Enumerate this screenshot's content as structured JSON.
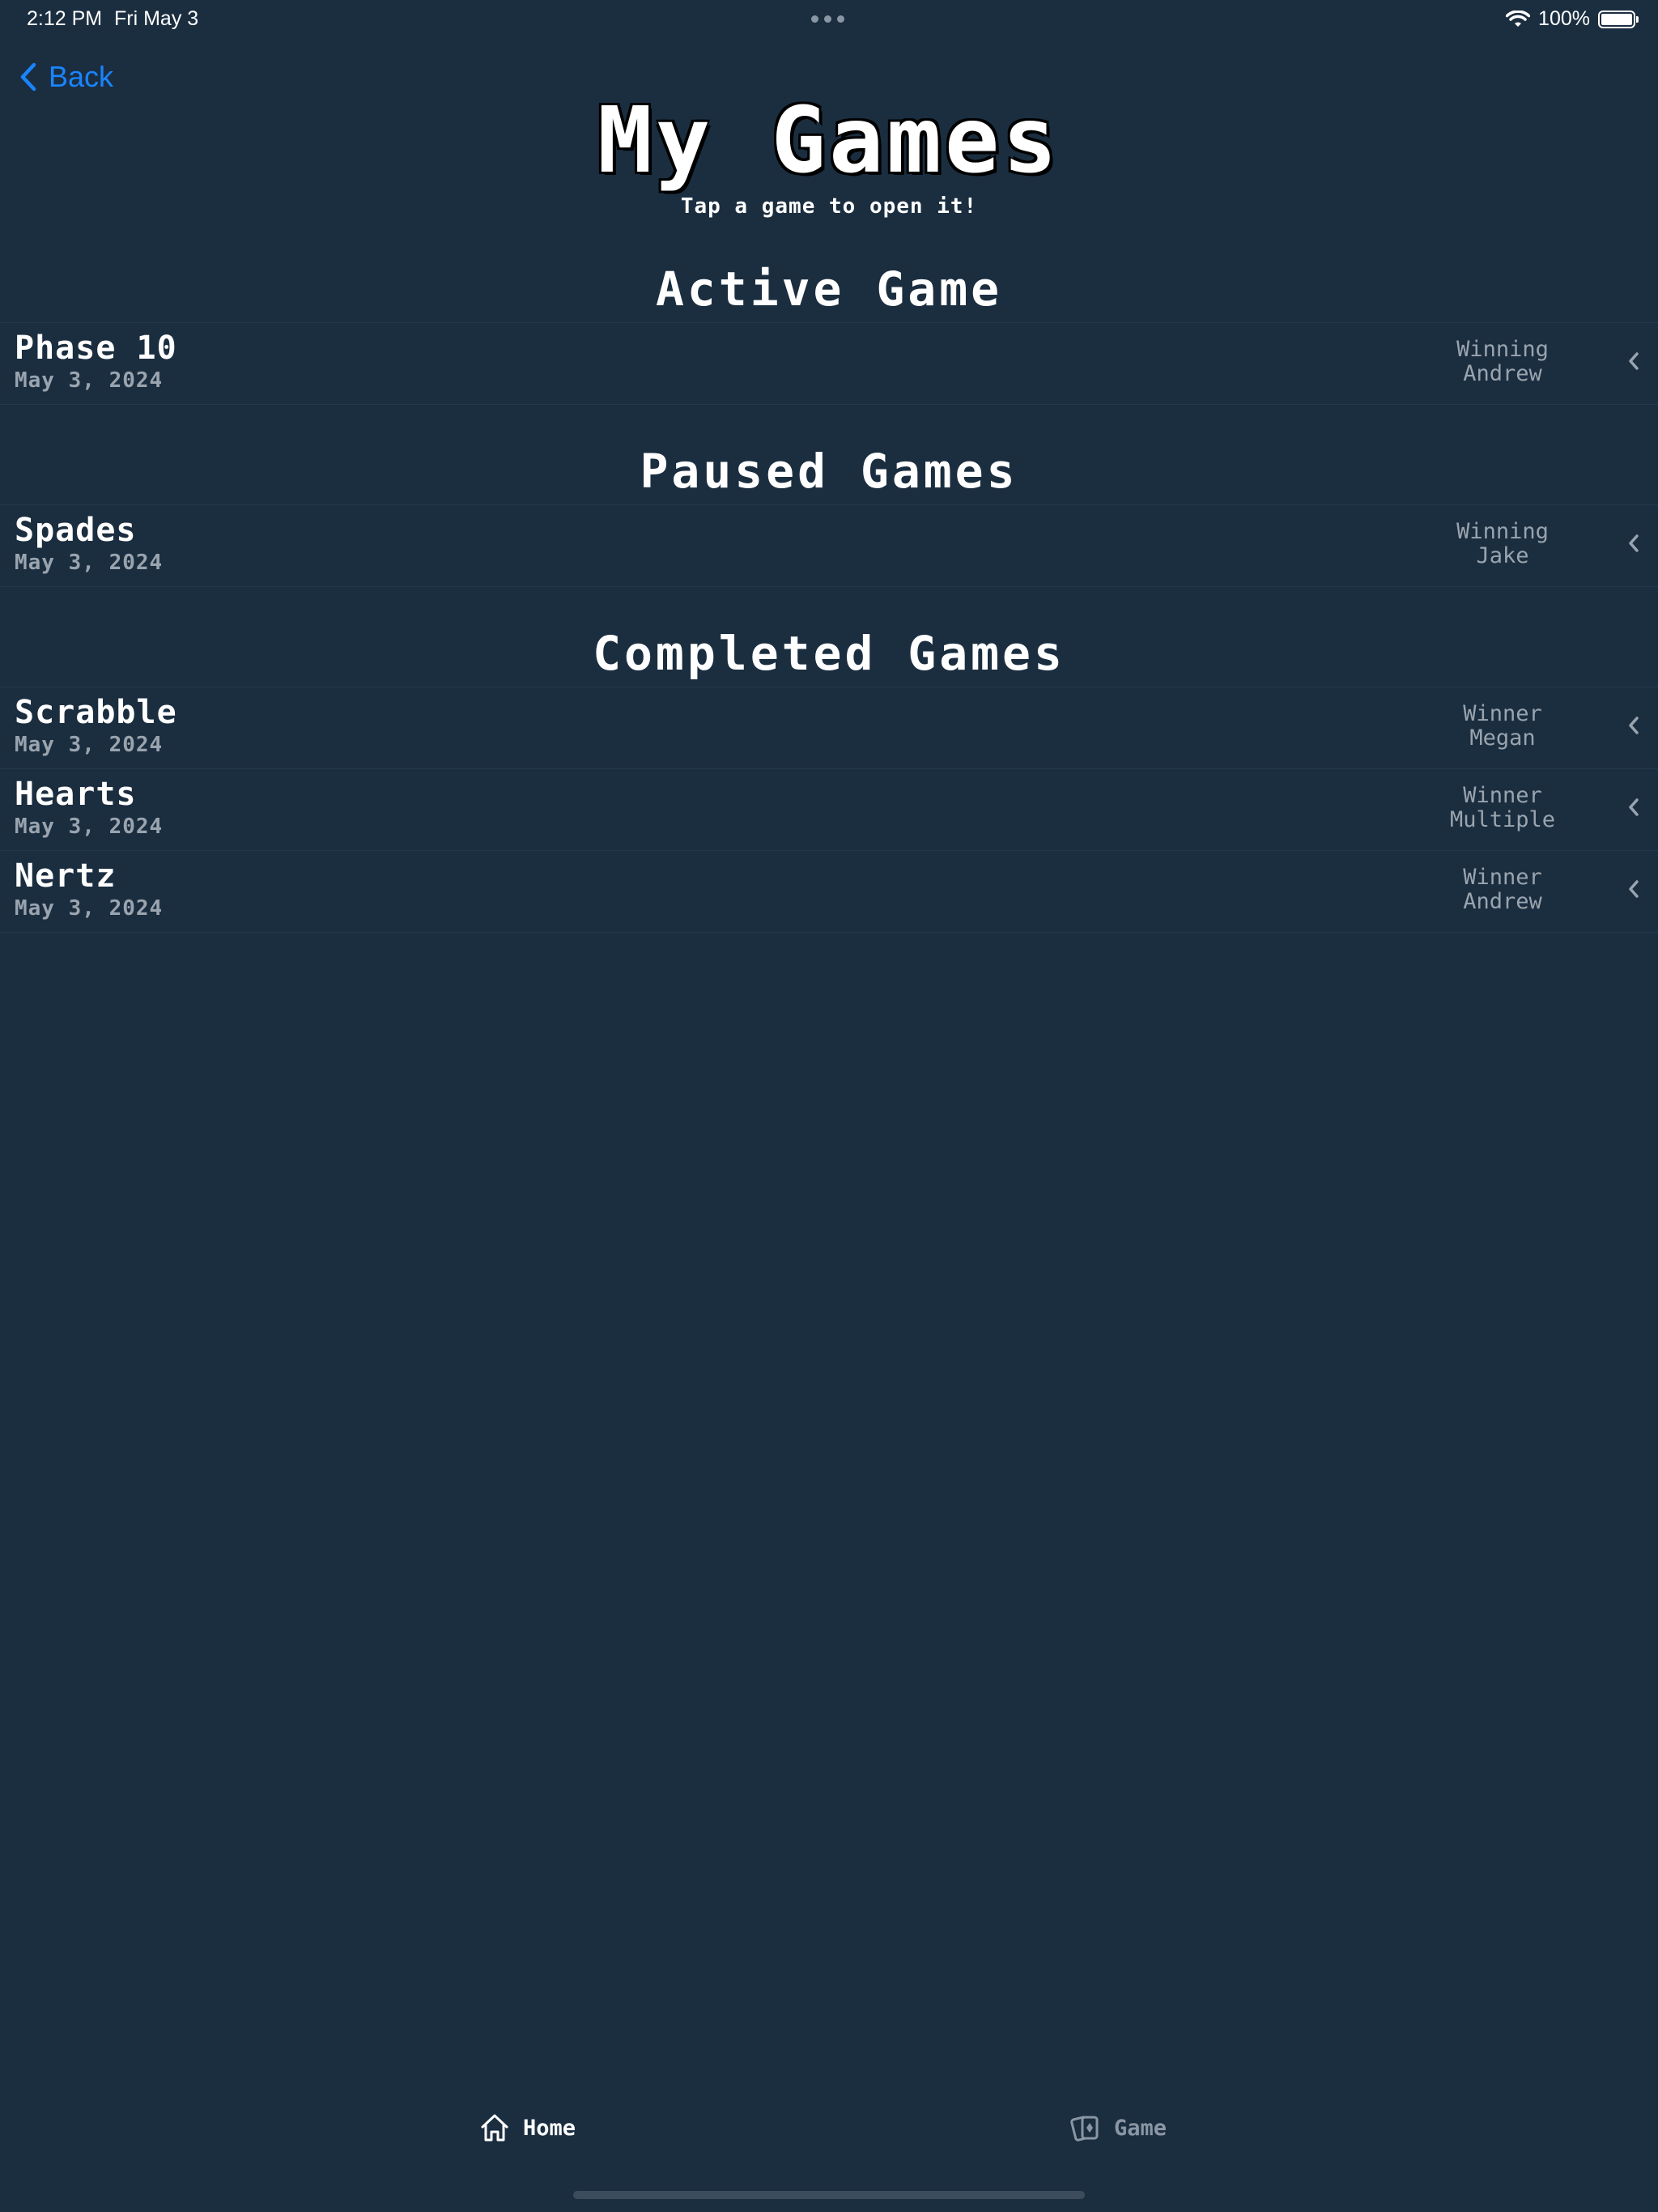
{
  "status_bar": {
    "time": "2:12 PM",
    "date": "Fri May 3",
    "battery": "100%"
  },
  "nav": {
    "back_label": "Back"
  },
  "header": {
    "title": "My Games",
    "subtitle": "Tap a game to open it!"
  },
  "sections": {
    "active": {
      "title": "Active Game",
      "games": [
        {
          "name": "Phase 10",
          "date": "May 3, 2024",
          "status_label": "Winning",
          "player": "Andrew"
        }
      ]
    },
    "paused": {
      "title": "Paused Games",
      "games": [
        {
          "name": "Spades",
          "date": "May 3, 2024",
          "status_label": "Winning",
          "player": "Jake"
        }
      ]
    },
    "completed": {
      "title": "Completed Games",
      "games": [
        {
          "name": "Scrabble",
          "date": "May 3, 2024",
          "status_label": "Winner",
          "player": "Megan"
        },
        {
          "name": "Hearts",
          "date": "May 3, 2024",
          "status_label": "Winner",
          "player": "Multiple"
        },
        {
          "name": "Nertz",
          "date": "May 3, 2024",
          "status_label": "Winner",
          "player": "Andrew"
        }
      ]
    }
  },
  "tab_bar": {
    "home_label": "Home",
    "game_label": "Game"
  },
  "icons": {
    "back": "chevron-left-icon",
    "row_chevron": "chevron-left-icon",
    "home": "house-icon",
    "game": "playing-cards-icon",
    "wifi": "wifi-icon",
    "battery": "battery-icon"
  },
  "colors": {
    "background": "#1b2e40",
    "accent": "#1a84ff",
    "secondary_text": "#9aa4ae"
  }
}
